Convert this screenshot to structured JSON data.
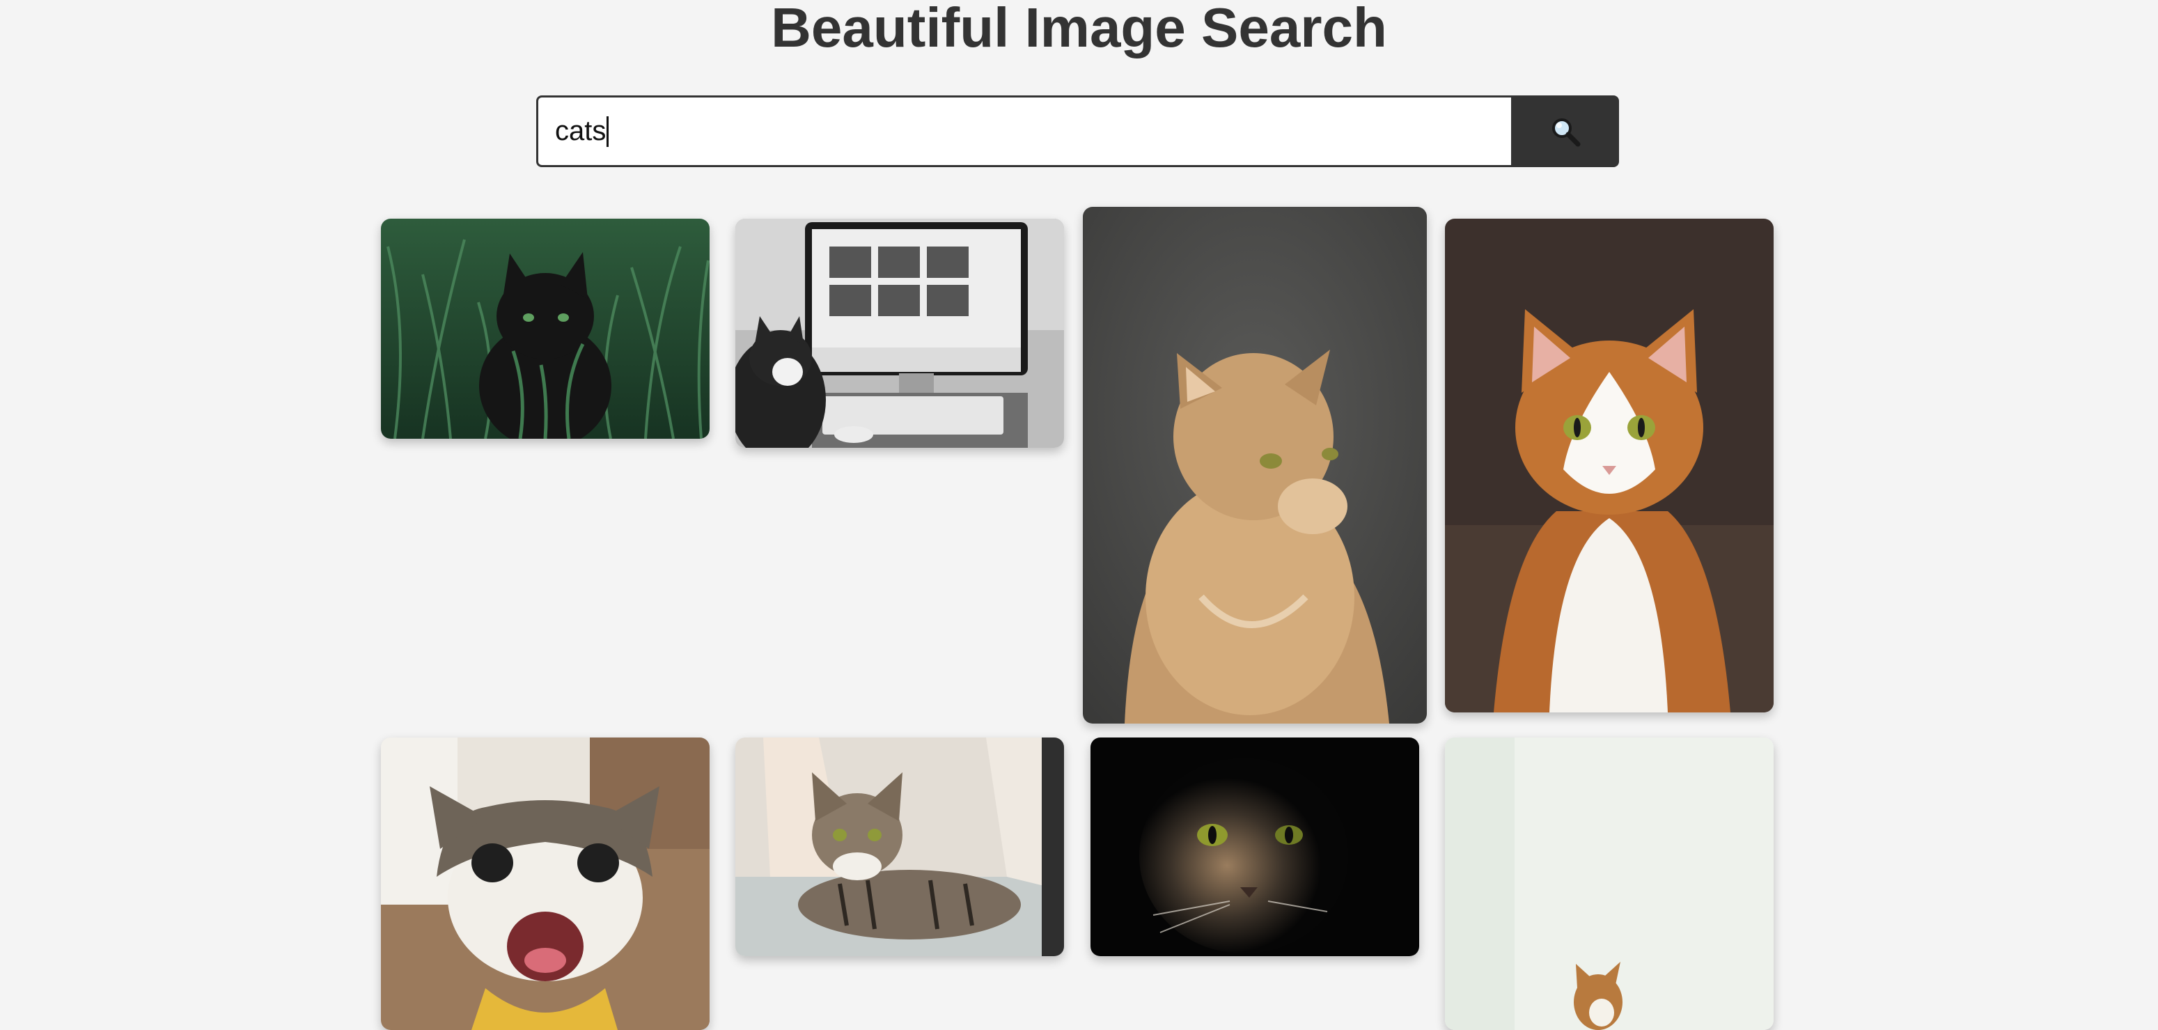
{
  "header": {
    "title": "Beautiful Image Search"
  },
  "search": {
    "value": "cats",
    "button_icon": "magnifier-icon"
  },
  "results": [
    {
      "name": "black-cat-in-grass-image",
      "icon": "photo"
    },
    {
      "name": "cat-at-computer-image",
      "icon": "photo"
    },
    {
      "name": "fluffy-orange-cat-image",
      "icon": "photo"
    },
    {
      "name": "orange-white-cat-image",
      "icon": "photo"
    },
    {
      "name": "happy-tabby-cat-image",
      "icon": "photo"
    },
    {
      "name": "tabby-cat-on-couch-image",
      "icon": "photo"
    },
    {
      "name": "shadowed-cat-face-image",
      "icon": "photo"
    },
    {
      "name": "cat-on-white-background-image",
      "icon": "photo"
    }
  ],
  "colors": {
    "background": "#f4f4f4",
    "title": "#333333",
    "button": "#333333"
  }
}
